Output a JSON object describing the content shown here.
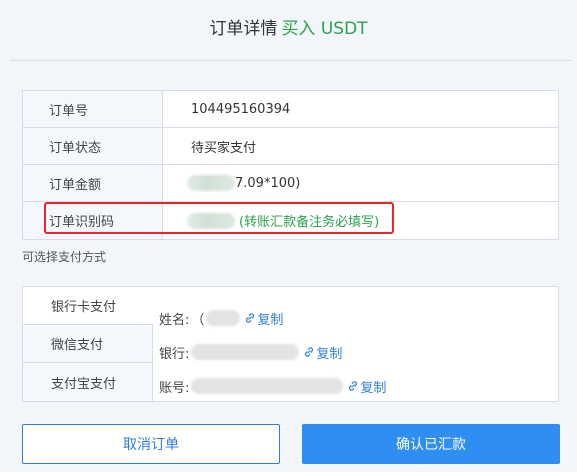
{
  "header": {
    "title": "订单详情",
    "title_accent": "买入 USDT"
  },
  "order": {
    "rows": [
      {
        "label": "订单号",
        "value": "104495160394"
      },
      {
        "label": "订单状态",
        "value": "待买家支付"
      },
      {
        "label": "订单金额",
        "value": "7.09*100)"
      },
      {
        "label": "订单识别码",
        "value": "(转账汇款备注务必填写)"
      }
    ]
  },
  "payment": {
    "section_label": "可选择支付方式",
    "tabs": [
      "银行卡支付",
      "微信支付",
      "支付宝支付"
    ],
    "name_label": "姓名:",
    "name_initial": "（",
    "bank_label": "银行:",
    "account_label": "账号:",
    "copy_label": "复制"
  },
  "actions": {
    "cancel_label": "取消订单",
    "confirm_label": "确认已汇款"
  },
  "colors": {
    "accent_green": "#2aa34a",
    "link_blue": "#2f7fd8",
    "primary_blue": "#2e8ef2",
    "highlight_red": "#e8262a"
  }
}
